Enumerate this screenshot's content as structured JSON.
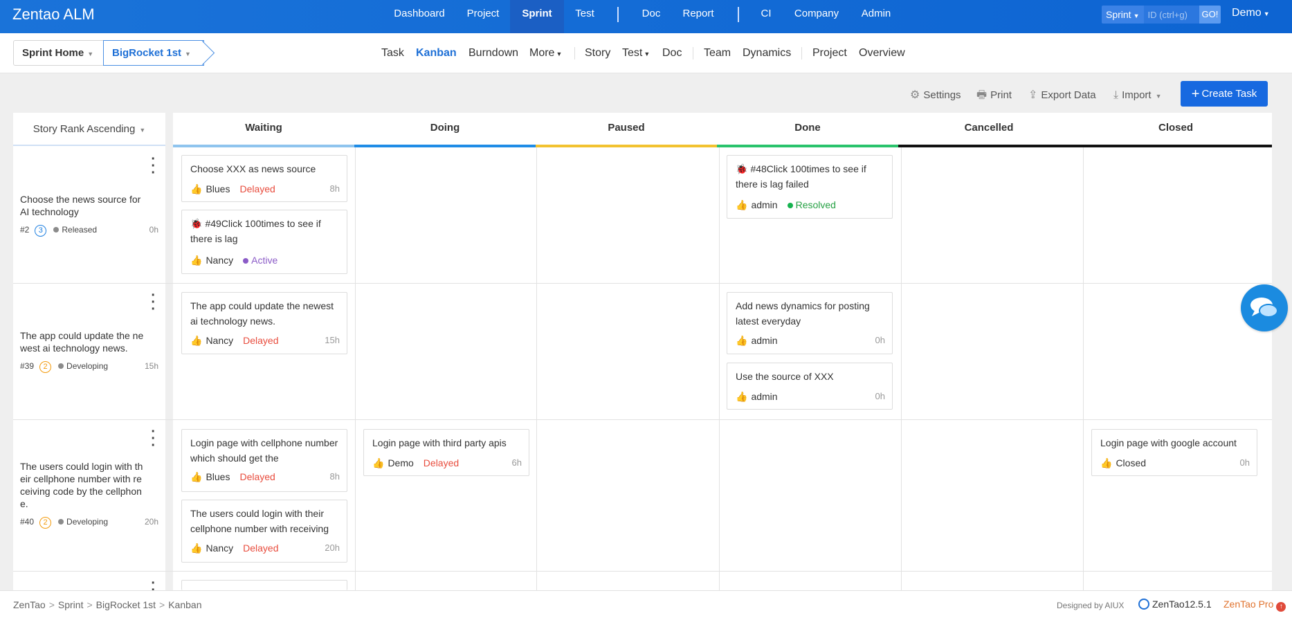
{
  "app": {
    "title": "Zentao ALM",
    "user": "Demo"
  },
  "main_nav": [
    "Dashboard",
    "Project",
    "Sprint",
    "Test",
    "Doc",
    "Report",
    "CI",
    "Company",
    "Admin"
  ],
  "search": {
    "type": "Sprint",
    "placeholder": "ID (ctrl+g)",
    "go": "GO!"
  },
  "breadcrumb_bar": {
    "home": "Sprint Home",
    "sprint": "BigRocket 1st"
  },
  "sub_nav": [
    "Task",
    "Kanban",
    "Burndown",
    "More",
    "Story",
    "Test",
    "Doc",
    "Team",
    "Dynamics",
    "Project",
    "Overview"
  ],
  "toolbar": {
    "settings": "Settings",
    "print": "Print",
    "export": "Export Data",
    "import": "Import",
    "create": "Create Task"
  },
  "board": {
    "sort": "Story Rank Ascending",
    "columns": [
      "Waiting",
      "Doing",
      "Paused",
      "Done",
      "Cancelled",
      "Closed"
    ],
    "column_colors": [
      "#8fc4ee",
      "#1f8ce6",
      "#f2c230",
      "#2ac36c",
      "#111111",
      "#111111"
    ],
    "lanes": [
      {
        "title": "Choose the news source for AI technology",
        "id": "#2",
        "pri": "3",
        "status": "Released",
        "est": "0h"
      },
      {
        "title": "The app could update the newest ai technology news.",
        "id": "#39",
        "pri": "2",
        "status": "Developing",
        "est": "15h"
      },
      {
        "title": "The users could login with their cellphone number with receiving code by the cellphone.",
        "id": "#40",
        "pri": "2",
        "status": "Developing",
        "est": "20h"
      }
    ],
    "cards": {
      "c1": {
        "title": "Choose XXX as news source",
        "user": "Blues",
        "status": "Delayed",
        "hours": "8h"
      },
      "c2": {
        "title": "#49Click 100times to see if there is lag",
        "user": "Nancy",
        "status": "Active"
      },
      "c3": {
        "title": "#48Click 100times to see if there is lag failed",
        "user": "admin",
        "status": "Resolved"
      },
      "c4": {
        "title": "The app could update the newest ai technology news.",
        "user": "Nancy",
        "status": "Delayed",
        "hours": "15h"
      },
      "c5": {
        "title": "Add news dynamics for posting latest everyday",
        "user": "admin",
        "hours": "0h"
      },
      "c6": {
        "title": "Use the source of XXX",
        "user": "admin",
        "hours": "0h"
      },
      "c7": {
        "title": "Login page with cellphone number which should get the authentication code",
        "user": "Blues",
        "status": "Delayed",
        "hours": "8h"
      },
      "c8": {
        "title": "The users could login with their cellphone number with receiving code by the cellphone.",
        "user": "Nancy",
        "status": "Delayed",
        "hours": "20h"
      },
      "c9": {
        "title": "Login page with third party apis",
        "user": "Demo",
        "status": "Delayed",
        "hours": "6h"
      },
      "c10": {
        "title": "Login page with google account",
        "user": "Closed",
        "hours": "0h"
      }
    }
  },
  "footer": {
    "crumbs": [
      "ZenTao",
      "Sprint",
      "BigRocket 1st",
      "Kanban"
    ],
    "designed": "Designed by AIUX",
    "version": "ZenTao12.5.1",
    "pro": "ZenTao Pro"
  }
}
